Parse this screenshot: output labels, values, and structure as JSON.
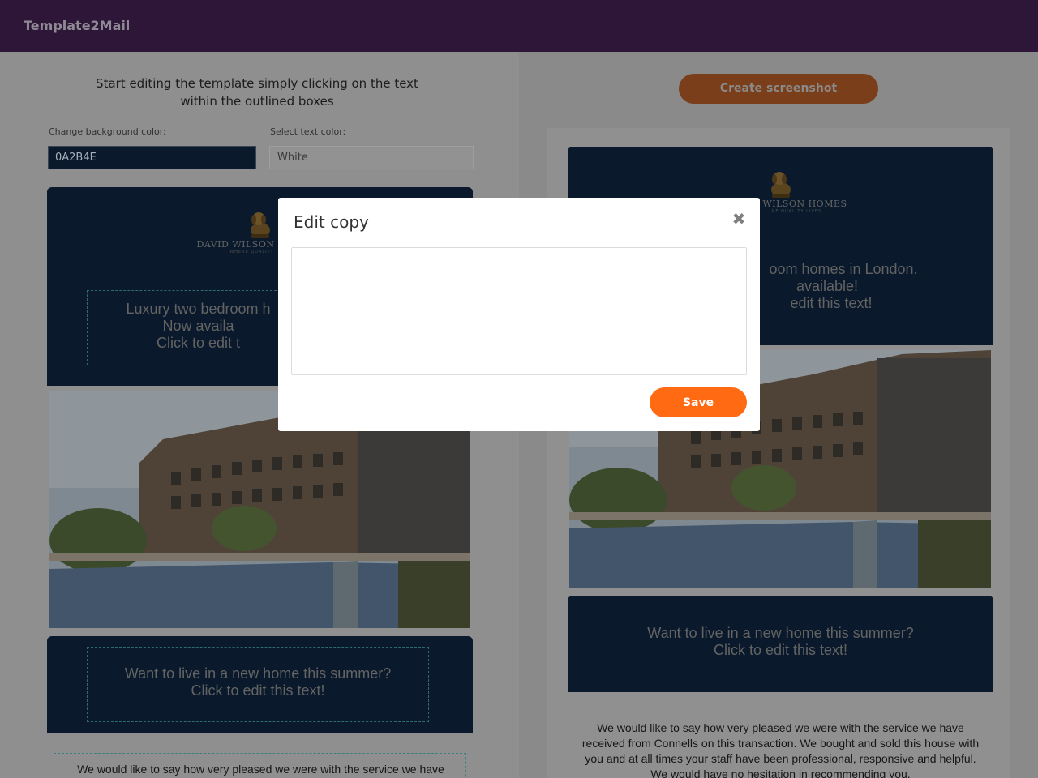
{
  "app": {
    "title": "Template2Mail"
  },
  "editor": {
    "intro_line1": "Start editing the template simply clicking on the text",
    "intro_line2": "within the outlined boxes",
    "bg_label": "Change background color:",
    "bg_value": "0A2B4E",
    "text_color_label": "Select text color:",
    "text_color_value": "White",
    "logo_name": "DAVID WILSON",
    "logo_tag": "WHERE QUALITY",
    "headline_line1": "Luxury two bedroom h",
    "headline_line2": "Now availa",
    "headline_line3": "Click to edit t",
    "promo_line1": "Want to live in a new home this summer?",
    "promo_line2": "Click to edit this text!",
    "testimonial_line1": "We would like to say how very pleased we were with the service we have"
  },
  "preview": {
    "screenshot_button": "Create screenshot",
    "logo_name": "WILSON HOMES",
    "logo_tag": "RE QUALITY LIVES",
    "headline_line1": "oom homes in London.",
    "headline_line2": "available!",
    "headline_line3": "edit this text!",
    "promo_line1": "Want to live in a new home this summer?",
    "promo_line2": "Click to edit this text!",
    "testimonial_line1": "We would like to say how very pleased we were with the service we have",
    "testimonial_line2": "received from Connells on this transaction. We bought and sold this house with",
    "testimonial_line3": "you and at all times your staff have been professional, responsive and helpful.",
    "testimonial_line4": "We would have no hesitation in recommending you."
  },
  "modal": {
    "title": "Edit copy",
    "close_glyph": "✖",
    "textarea_value": "",
    "save_label": "Save"
  },
  "colors": {
    "header_bg": "#2d1638",
    "accent": "#ff6a13",
    "navy": "#0a1a2c"
  }
}
